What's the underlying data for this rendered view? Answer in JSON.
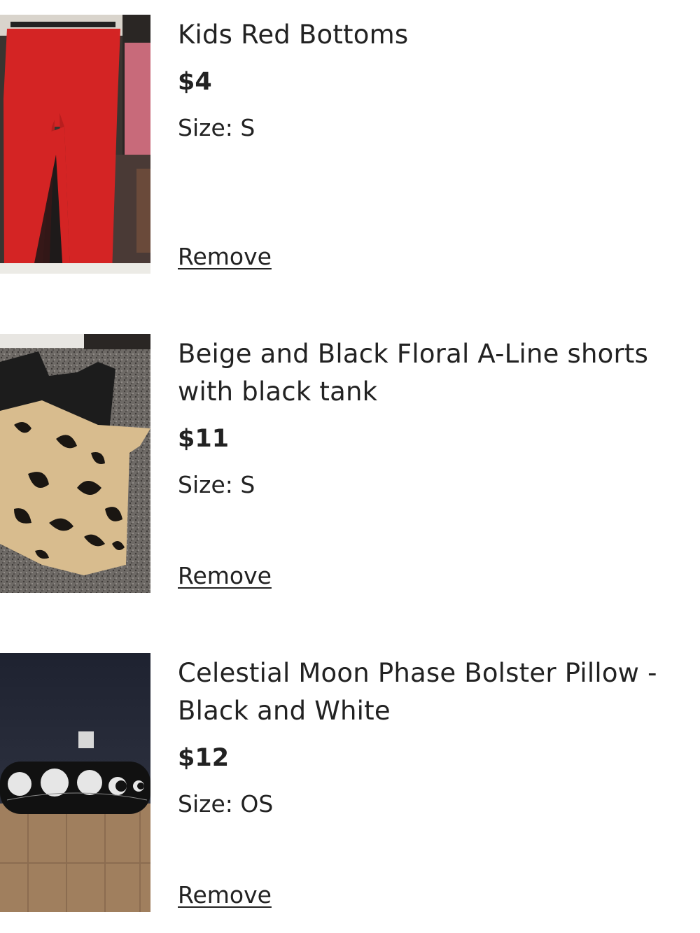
{
  "cart": {
    "items": [
      {
        "title": "Kids Red Bottoms",
        "price": "$4",
        "size": "Size: S",
        "remove_label": "Remove",
        "image_desc": "red-leggings-photo"
      },
      {
        "title": "Beige and Black Floral A-Line shorts with black tank",
        "price": "$11",
        "size": "Size: S",
        "remove_label": "Remove",
        "image_desc": "floral-shorts-and-tank-photo"
      },
      {
        "title": "Celestial Moon Phase Bolster Pillow - Black and White",
        "price": "$12",
        "size": "Size: OS",
        "remove_label": "Remove",
        "image_desc": "moon-phase-pillow-photo"
      }
    ]
  },
  "colors": {
    "text": "#222222",
    "background": "#ffffff"
  }
}
